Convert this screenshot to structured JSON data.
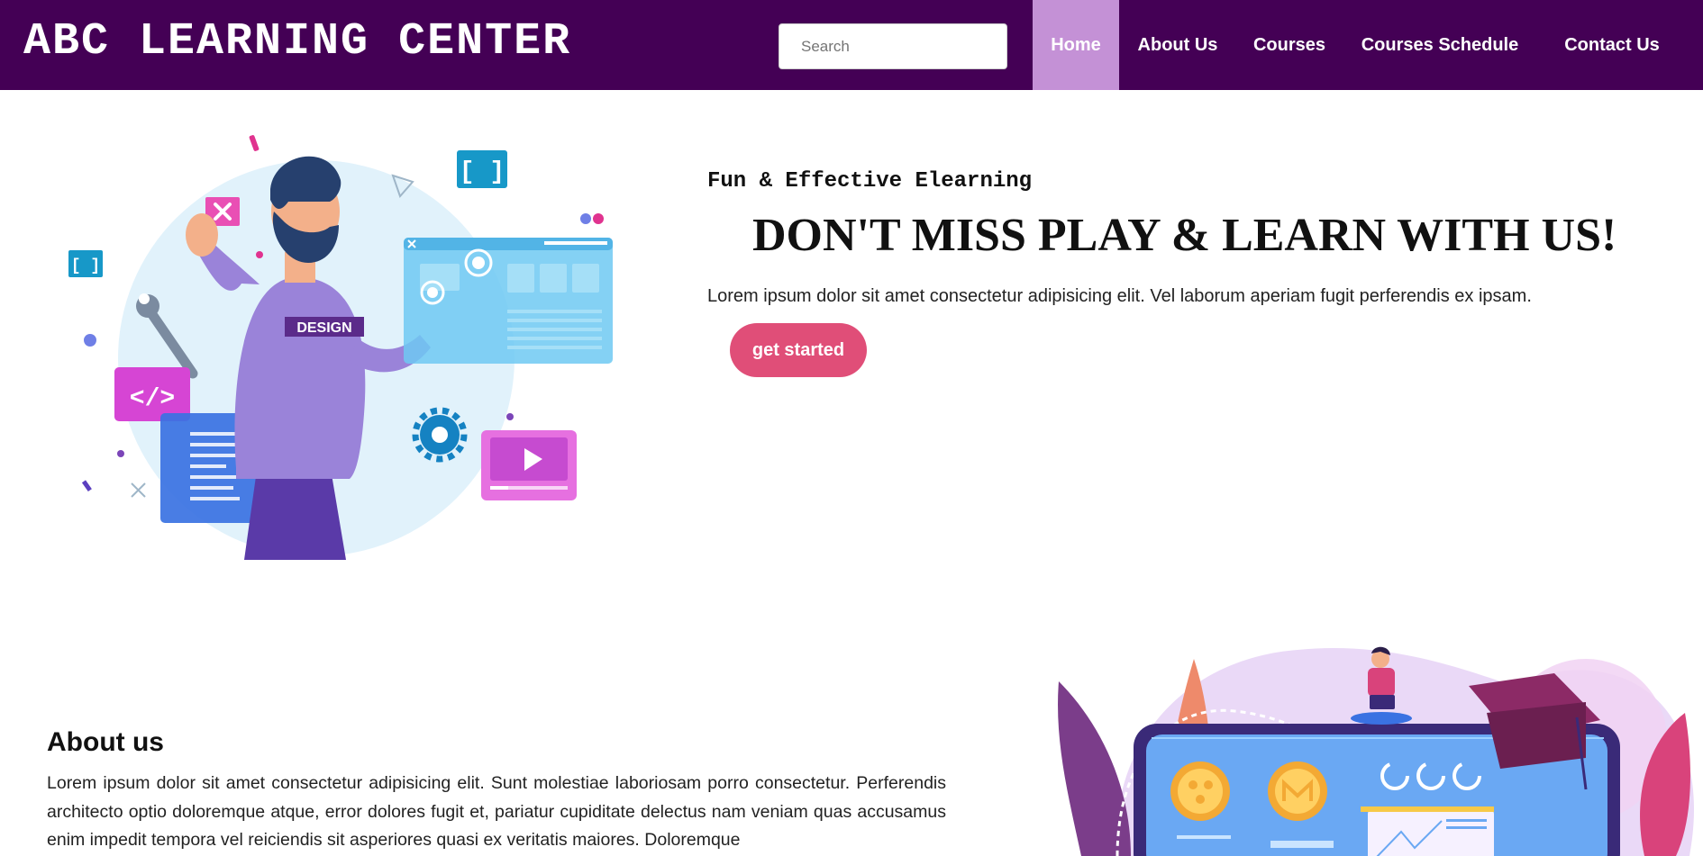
{
  "header": {
    "brand": "ABC LEARNING CENTER",
    "search_placeholder": "Search",
    "nav": {
      "home": "Home",
      "about": "About Us",
      "courses": "Courses",
      "schedule": "Courses Schedule",
      "contact": "Contact Us"
    }
  },
  "hero": {
    "subtitle": "Fun & Effective Elearning",
    "headline": "DON'T MISS PLAY & LEARN WITH US!",
    "lead": "Lorem ipsum dolor sit amet consectetur adipisicing elit. Vel laborum aperiam fugit perferendis ex ipsam.",
    "cta": "get started",
    "shirt_text": "DESIGN"
  },
  "about": {
    "title": "About us",
    "text": "Lorem ipsum dolor sit amet consectetur adipisicing elit. Sunt molestiae laboriosam porro consectetur. Perferendis architecto optio doloremque atque, error dolores fugit et, pariatur cupiditate delectus nam veniam quas accusamus enim impedit tempora vel reiciendis sit asperiores quasi ex veritatis maiores. Doloremque"
  },
  "colors": {
    "header_bg": "#440055",
    "nav_active": "#c491d6",
    "cta": "#e04e78"
  }
}
